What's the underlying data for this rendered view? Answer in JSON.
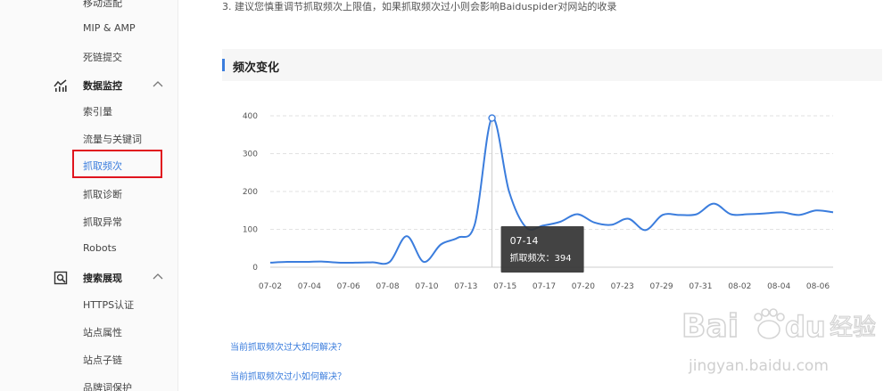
{
  "sidebar": {
    "items_top": [
      {
        "label": "移动适配"
      },
      {
        "label": "MIP & AMP"
      },
      {
        "label": "死链提交"
      }
    ],
    "group_monitor": {
      "label": "数据监控",
      "icon": "chart-icon",
      "items": [
        {
          "label": "索引量"
        },
        {
          "label": "流量与关键词"
        },
        {
          "label": "抓取频次",
          "active": true
        },
        {
          "label": "抓取诊断"
        },
        {
          "label": "抓取异常"
        },
        {
          "label": "Robots"
        }
      ]
    },
    "group_search": {
      "label": "搜索展现",
      "icon": "search-display-icon",
      "items": [
        {
          "label": "HTTPS认证"
        },
        {
          "label": "站点属性"
        },
        {
          "label": "站点子链"
        },
        {
          "label": "品牌词保护"
        }
      ]
    }
  },
  "main": {
    "tip_text": "3. 建议您慎重调节抓取频次上限值，如果抓取频次过小则会影响Baiduspider对网站的收录",
    "section_title": "频次变化",
    "tooltip": {
      "date": "07-14",
      "label": "抓取频次：394"
    },
    "faq_links": [
      {
        "label": "当前抓取频次过大如何解决？"
      },
      {
        "label": "当前抓取频次过小如何解决？"
      }
    ],
    "watermark": {
      "brand": "Bai du 经验",
      "url": "jingyan.baidu.com"
    }
  },
  "colors": {
    "accent": "#3b7ddd",
    "highlight_box": "#e0141e",
    "tooltip_bg": "#333333"
  },
  "chart_data": {
    "type": "line",
    "x_tick_labels": [
      "07-02",
      "07-04",
      "07-06",
      "07-08",
      "07-10",
      "07-13",
      "07-15",
      "07-17",
      "07-20",
      "07-23",
      "07-29",
      "07-31",
      "08-02",
      "08-04",
      "08-06"
    ],
    "y_ticks": [
      0,
      100,
      200,
      300,
      400
    ],
    "ylim": [
      0,
      400
    ],
    "series": [
      {
        "values": [
          12,
          14,
          14,
          15,
          12,
          12,
          13,
          14,
          82,
          14,
          60,
          78,
          115,
          394,
          200,
          105,
          110,
          120,
          140,
          118,
          112,
          128,
          98,
          138,
          138,
          140,
          168,
          140,
          140,
          142,
          145,
          138,
          150,
          145
        ]
      }
    ],
    "highlight": {
      "date": "07-14",
      "value": 394
    },
    "grid": true
  }
}
